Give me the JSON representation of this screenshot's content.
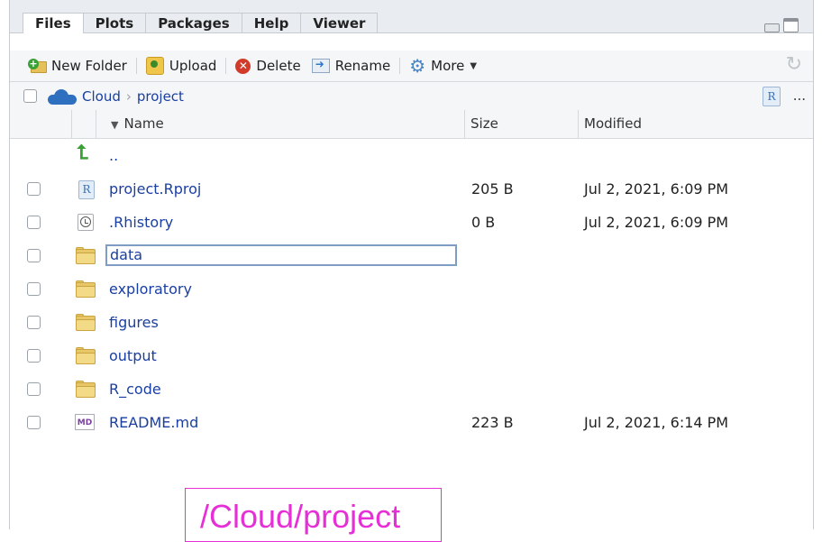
{
  "tabs": [
    "Files",
    "Plots",
    "Packages",
    "Help",
    "Viewer"
  ],
  "active_tab": "Files",
  "toolbar": {
    "new_folder": "New Folder",
    "upload": "Upload",
    "delete": "Delete",
    "rename": "Rename",
    "more": "More"
  },
  "path": {
    "root": "Cloud",
    "current": "project",
    "more_menu": "..."
  },
  "columns": {
    "name": "Name",
    "size": "Size",
    "modified": "Modified"
  },
  "parent_dir": "..",
  "files": [
    {
      "name": "project.Rproj",
      "size": "205 B",
      "modified": "Jul 2, 2021, 6:09 PM",
      "icon": "rproj-icon"
    },
    {
      "name": ".Rhistory",
      "size": "0 B",
      "modified": "Jul 2, 2021, 6:09 PM",
      "icon": "history-icon"
    },
    {
      "name": "data",
      "size": "",
      "modified": "",
      "icon": "folder-icon"
    },
    {
      "name": "exploratory",
      "size": "",
      "modified": "",
      "icon": "folder-icon"
    },
    {
      "name": "figures",
      "size": "",
      "modified": "",
      "icon": "folder-icon"
    },
    {
      "name": "output",
      "size": "",
      "modified": "",
      "icon": "folder-icon"
    },
    {
      "name": "R_code",
      "size": "",
      "modified": "",
      "icon": "folder-icon"
    },
    {
      "name": "README.md",
      "size": "223 B",
      "modified": "Jul 2, 2021, 6:14 PM",
      "icon": "markdown-icon"
    }
  ],
  "overlay_label": "/Cloud/project",
  "colors": {
    "link": "#1a3fa0",
    "overlay": "#e62fd6",
    "folder": "#e7c768"
  }
}
